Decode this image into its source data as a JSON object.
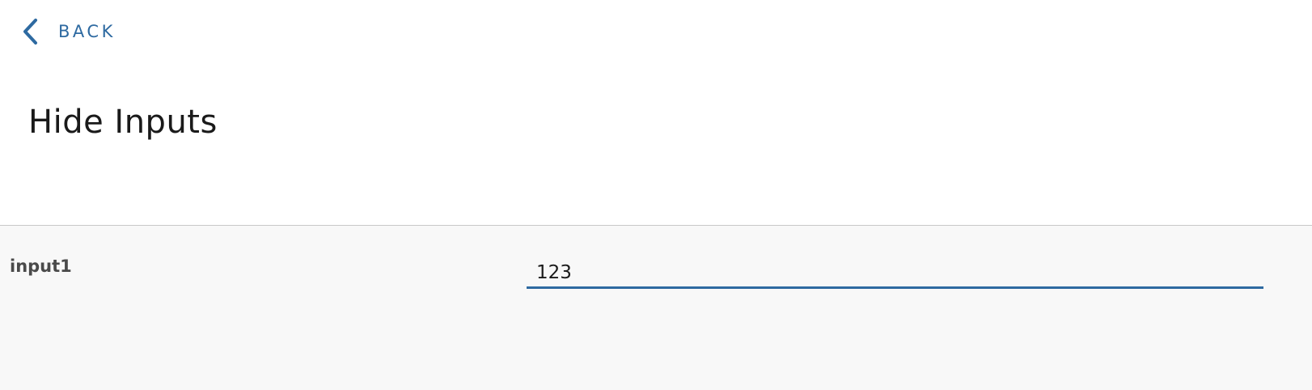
{
  "header": {
    "back_label": "BACK",
    "back_icon": "chevron-left-icon",
    "title": "Hide Inputs"
  },
  "form": {
    "fields": [
      {
        "label": "input1",
        "value": "123",
        "placeholder": ""
      }
    ]
  },
  "colors": {
    "accent": "#2e6aa1",
    "title_text": "#1a1a1a",
    "label_text": "#4a4a4a",
    "content_background": "#f8f8f8",
    "divider": "#c8c8c8"
  }
}
